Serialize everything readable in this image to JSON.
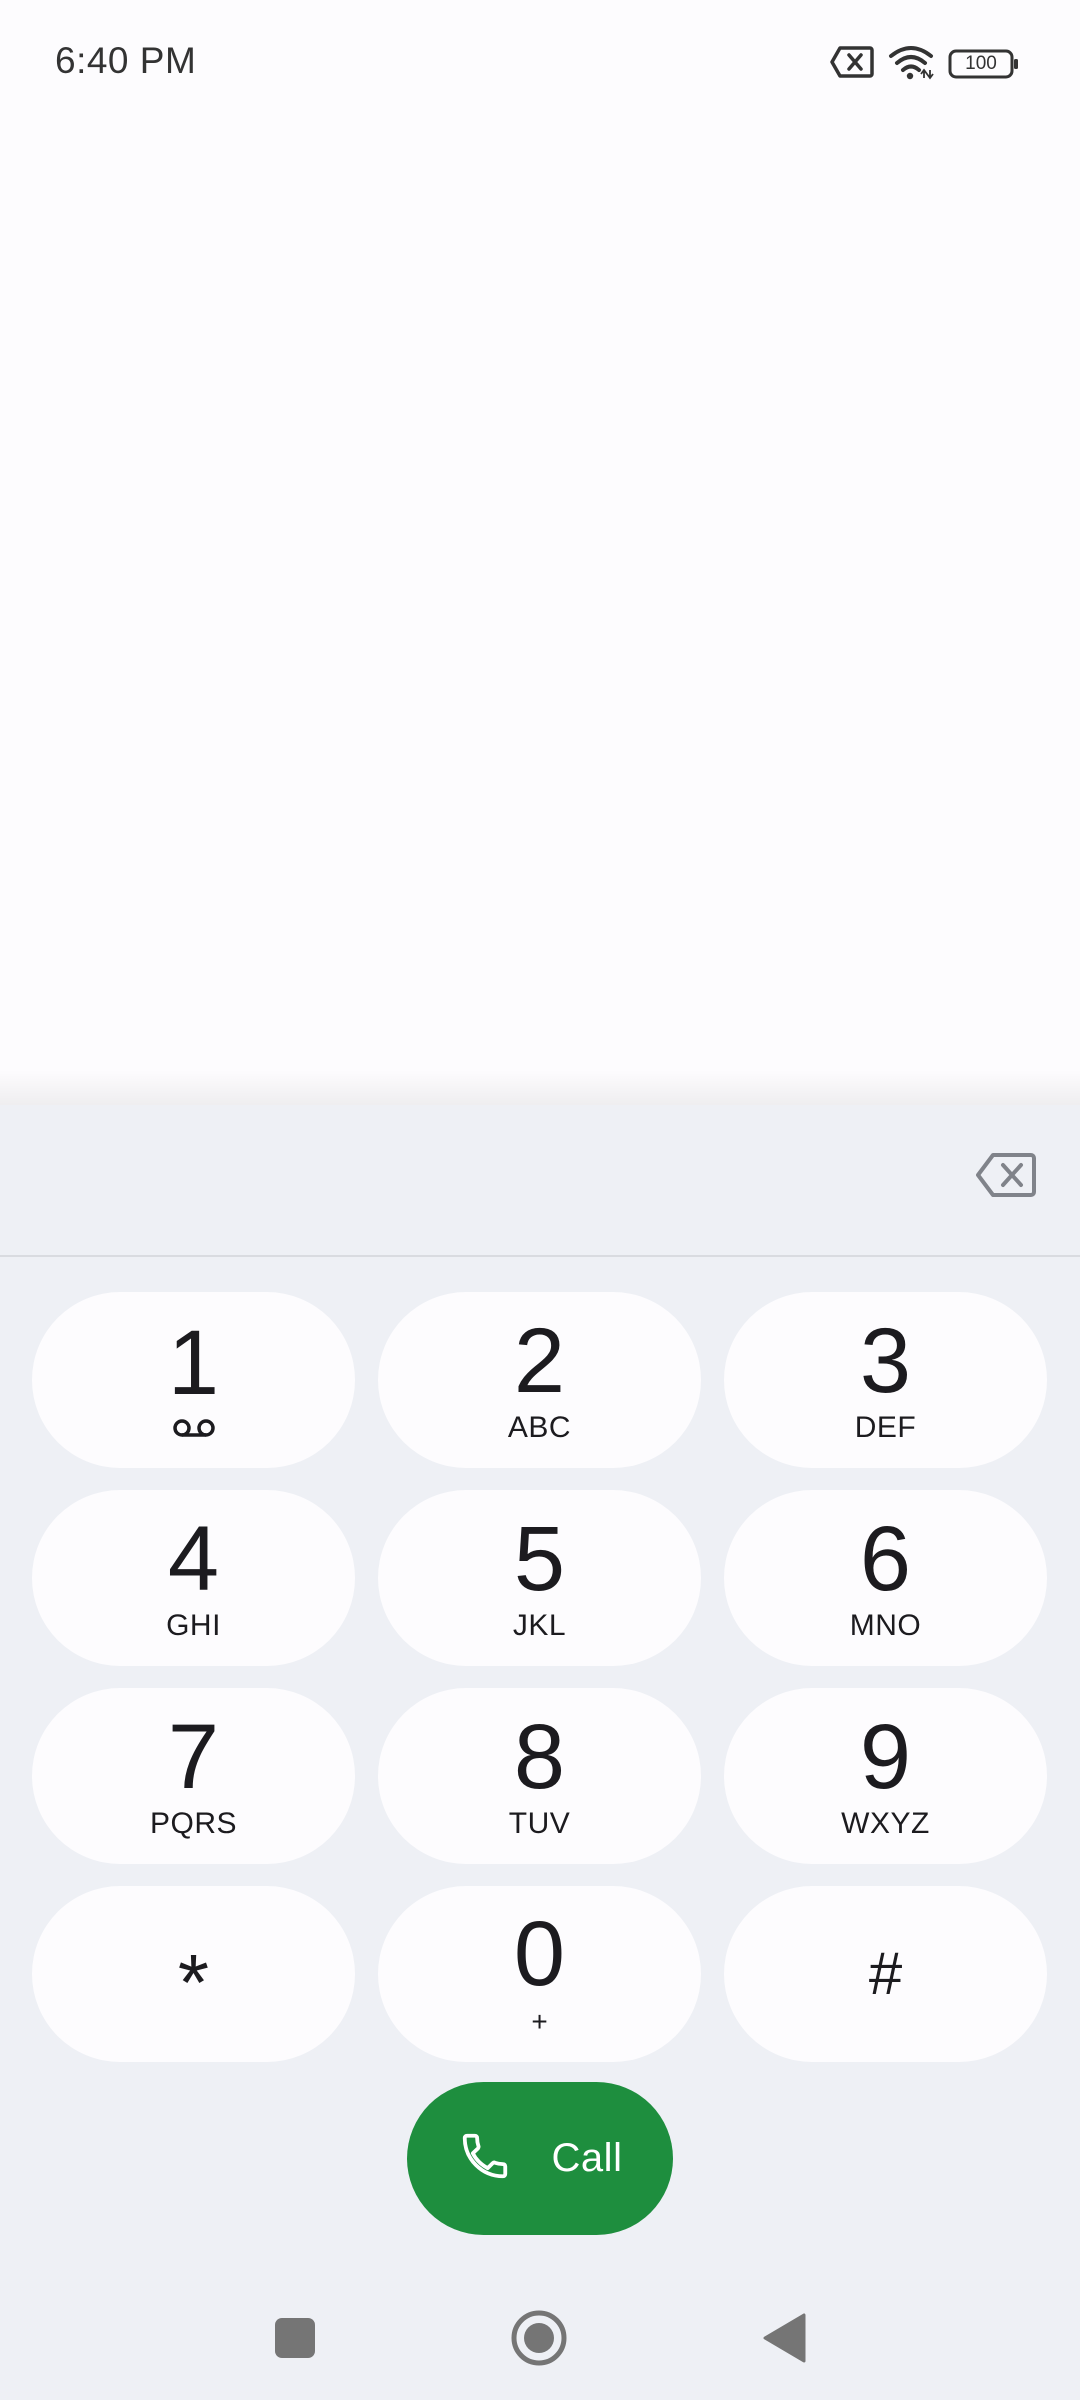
{
  "status_bar": {
    "time": "6:40 PM",
    "battery": "100",
    "icons": [
      "sim-x-icon",
      "wifi-icon",
      "battery-icon"
    ]
  },
  "dial_input": {
    "value": ""
  },
  "keypad": [
    {
      "digit": "1",
      "letters": "",
      "icon": "voicemail-icon"
    },
    {
      "digit": "2",
      "letters": "ABC"
    },
    {
      "digit": "3",
      "letters": "DEF"
    },
    {
      "digit": "4",
      "letters": "GHI"
    },
    {
      "digit": "5",
      "letters": "JKL"
    },
    {
      "digit": "6",
      "letters": "MNO"
    },
    {
      "digit": "7",
      "letters": "PQRS"
    },
    {
      "digit": "8",
      "letters": "TUV"
    },
    {
      "digit": "9",
      "letters": "WXYZ"
    },
    {
      "digit": "*",
      "letters": ""
    },
    {
      "digit": "0",
      "letters": "+"
    },
    {
      "digit": "#",
      "letters": ""
    }
  ],
  "call_button": {
    "label": "Call",
    "icon": "phone-icon",
    "color": "#1e8e3e"
  },
  "nav_bar": {
    "icons": [
      "recents-square-icon",
      "home-circle-icon",
      "back-triangle-icon"
    ]
  }
}
